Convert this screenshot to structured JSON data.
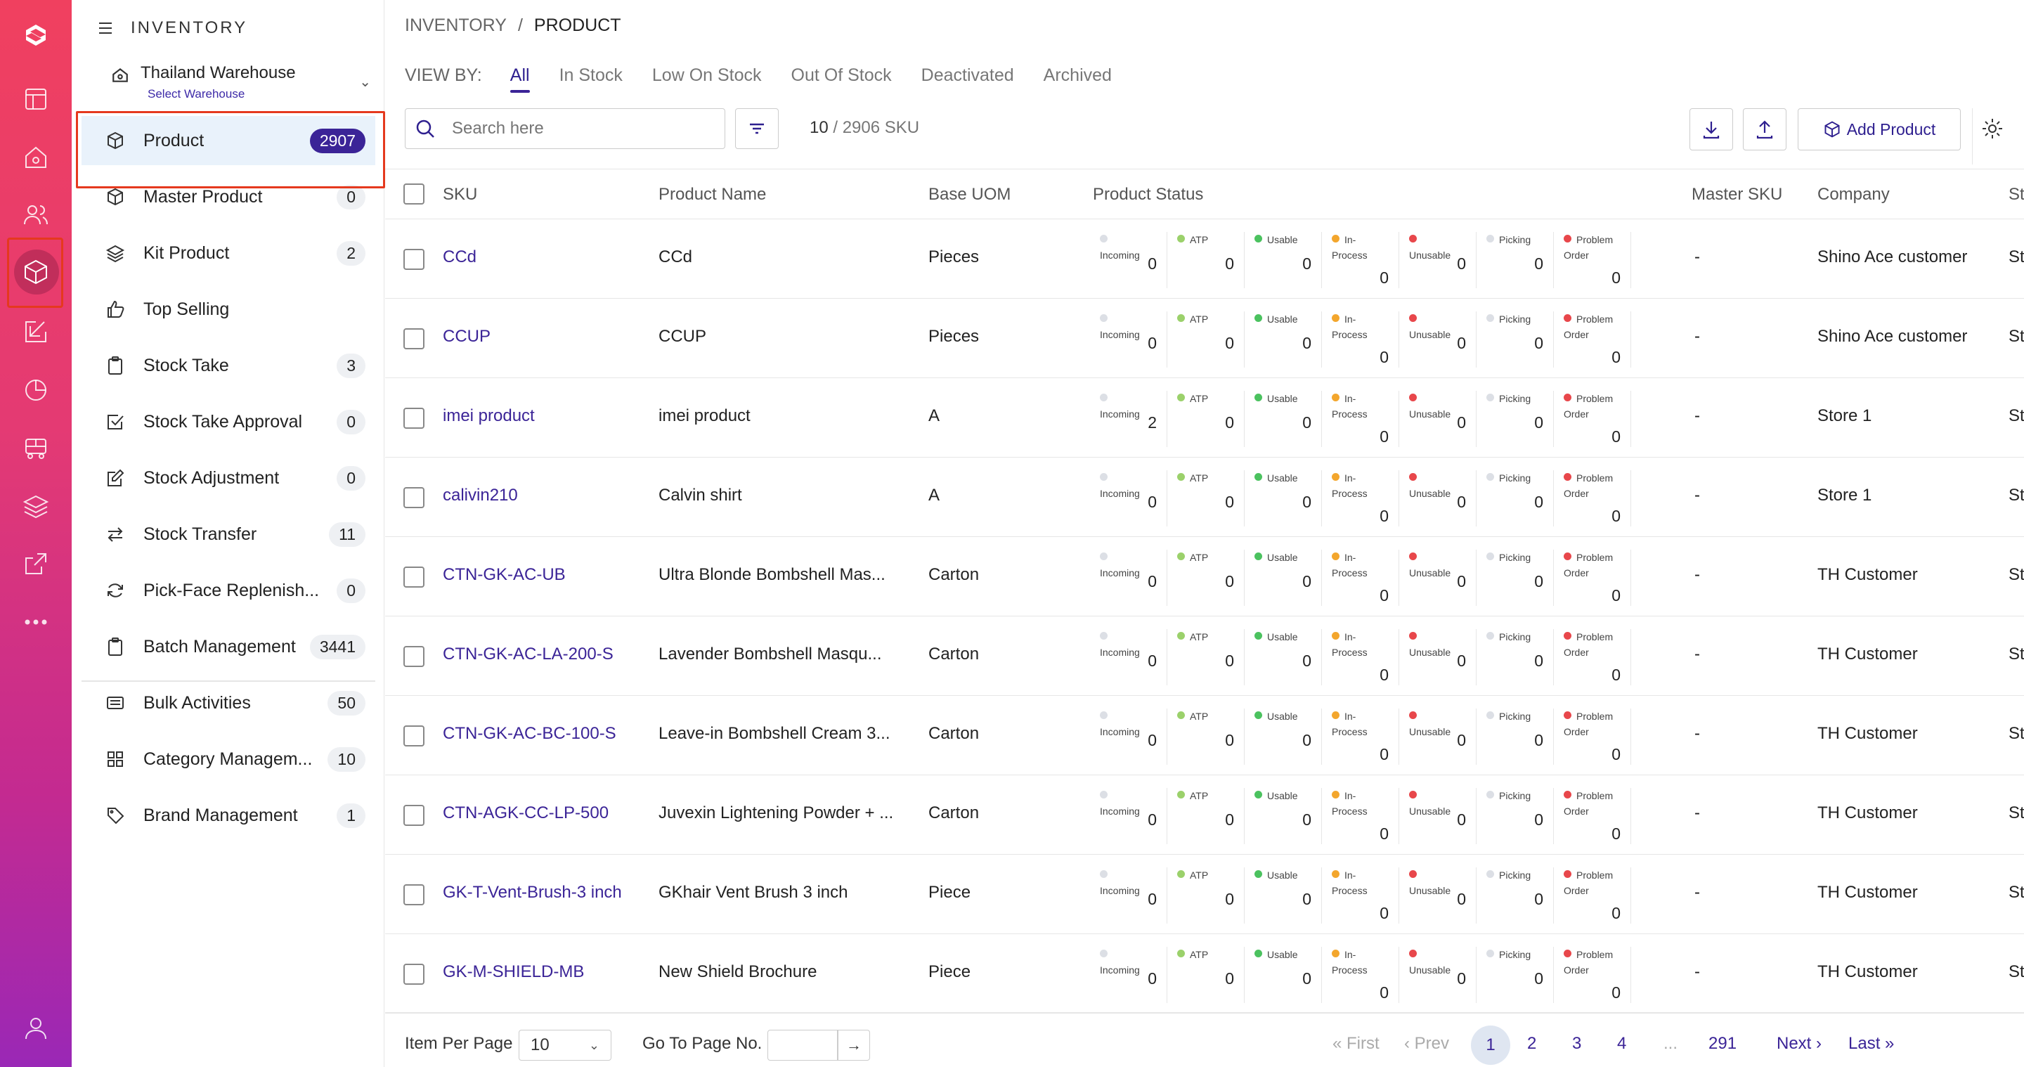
{
  "module": {
    "title": "INVENTORY"
  },
  "warehouse": {
    "name": "Thailand Warehouse",
    "sub": "Select Warehouse"
  },
  "nav": [
    {
      "label": "Product",
      "count": "2907",
      "icon": "cube-icon"
    },
    {
      "label": "Master Product",
      "count": "0",
      "icon": "cube-icon"
    },
    {
      "label": "Kit Product",
      "count": "2",
      "icon": "layers-icon"
    },
    {
      "label": "Top Selling",
      "count": "",
      "icon": "thumbs-up-icon"
    },
    {
      "label": "Stock Take",
      "count": "3",
      "icon": "clipboard-icon"
    },
    {
      "label": "Stock Take Approval",
      "count": "0",
      "icon": "check-square-icon"
    },
    {
      "label": "Stock Adjustment",
      "count": "0",
      "icon": "edit-icon"
    },
    {
      "label": "Stock Transfer",
      "count": "11",
      "icon": "transfer-icon"
    },
    {
      "label": "Pick-Face Replenish...",
      "count": "0",
      "icon": "refresh-icon"
    },
    {
      "label": "Batch Management",
      "count": "3441",
      "icon": "clipboard-icon"
    },
    {
      "label": "Bulk Activities",
      "count": "50",
      "icon": "list-icon"
    },
    {
      "label": "Category Managem...",
      "count": "10",
      "icon": "grid-icon"
    },
    {
      "label": "Brand Management",
      "count": "1",
      "icon": "tag-icon"
    }
  ],
  "breadcrumb": {
    "root": "INVENTORY",
    "sep": "/",
    "current": "PRODUCT"
  },
  "viewby": {
    "label": "VIEW BY:",
    "tabs": [
      "All",
      "In Stock",
      "Low On Stock",
      "Out Of Stock",
      "Deactivated",
      "Archived"
    ]
  },
  "search": {
    "placeholder": "Search here"
  },
  "sku_count": {
    "shown": "10",
    "total": "/ 2906 SKU"
  },
  "toolbar": {
    "add_label": "Add Product"
  },
  "columns": {
    "sku": "SKU",
    "name": "Product Name",
    "uom": "Base UOM",
    "status": "Product Status",
    "master": "Master SKU",
    "company": "Company",
    "more": "St"
  },
  "status_labels": [
    "Incoming",
    "ATP",
    "Usable",
    "In-Process",
    "Unusable",
    "Picking",
    "Problem Order"
  ],
  "status_colors": [
    "#dcdfe5",
    "#9bd16b",
    "#4bc25f",
    "#f3a62d",
    "#e8474b",
    "#dcdfe5",
    "#e8474b"
  ],
  "rows": [
    {
      "sku": "CCd",
      "name": "CCd",
      "uom": "Pieces",
      "status": [
        "0",
        "0",
        "0",
        "0",
        "0",
        "0",
        "0"
      ],
      "master": "-",
      "company": "Shino Ace customer",
      "more": "St"
    },
    {
      "sku": "CCUP",
      "name": "CCUP",
      "uom": "Pieces",
      "status": [
        "0",
        "0",
        "0",
        "0",
        "0",
        "0",
        "0"
      ],
      "master": "-",
      "company": "Shino Ace customer",
      "more": "St"
    },
    {
      "sku": "imei product",
      "name": "imei product",
      "uom": "A",
      "status": [
        "2",
        "0",
        "0",
        "0",
        "0",
        "0",
        "0"
      ],
      "master": "-",
      "company": "Store 1",
      "more": "St"
    },
    {
      "sku": "calivin210",
      "name": "Calvin shirt",
      "uom": "A",
      "status": [
        "0",
        "0",
        "0",
        "0",
        "0",
        "0",
        "0"
      ],
      "master": "-",
      "company": "Store 1",
      "more": "St"
    },
    {
      "sku": "CTN-GK-AC-UB",
      "name": "Ultra Blonde Bombshell Mas...",
      "uom": "Carton",
      "status": [
        "0",
        "0",
        "0",
        "0",
        "0",
        "0",
        "0"
      ],
      "master": "-",
      "company": "TH Customer",
      "more": "St"
    },
    {
      "sku": "CTN-GK-AC-LA-200-S",
      "name": "Lavender Bombshell Masqu...",
      "uom": "Carton",
      "status": [
        "0",
        "0",
        "0",
        "0",
        "0",
        "0",
        "0"
      ],
      "master": "-",
      "company": "TH Customer",
      "more": "St"
    },
    {
      "sku": "CTN-GK-AC-BC-100-S",
      "name": "Leave-in Bombshell Cream 3...",
      "uom": "Carton",
      "status": [
        "0",
        "0",
        "0",
        "0",
        "0",
        "0",
        "0"
      ],
      "master": "-",
      "company": "TH Customer",
      "more": "St"
    },
    {
      "sku": "CTN-AGK-CC-LP-500",
      "name": "Juvexin Lightening Powder + ...",
      "uom": "Carton",
      "status": [
        "0",
        "0",
        "0",
        "0",
        "0",
        "0",
        "0"
      ],
      "master": "-",
      "company": "TH Customer",
      "more": "St"
    },
    {
      "sku": "GK-T-Vent-Brush-3 inch",
      "name": "GKhair Vent Brush 3 inch",
      "uom": "Piece",
      "status": [
        "0",
        "0",
        "0",
        "0",
        "0",
        "0",
        "0"
      ],
      "master": "-",
      "company": "TH Customer",
      "more": "St"
    },
    {
      "sku": "GK-M-SHIELD-MB",
      "name": "New Shield Brochure",
      "uom": "Piece",
      "status": [
        "0",
        "0",
        "0",
        "0",
        "0",
        "0",
        "0"
      ],
      "master": "-",
      "company": "TH Customer",
      "more": "St"
    }
  ],
  "footer": {
    "per_page_label": "Item Per Page",
    "per_page_value": "10",
    "goto_label": "Go To Page No.",
    "first": "First",
    "prev": "Prev",
    "pages": [
      "1",
      "2",
      "3",
      "4"
    ],
    "ellipsis": "...",
    "last_page": "291",
    "next": "Next",
    "last": "Last"
  }
}
